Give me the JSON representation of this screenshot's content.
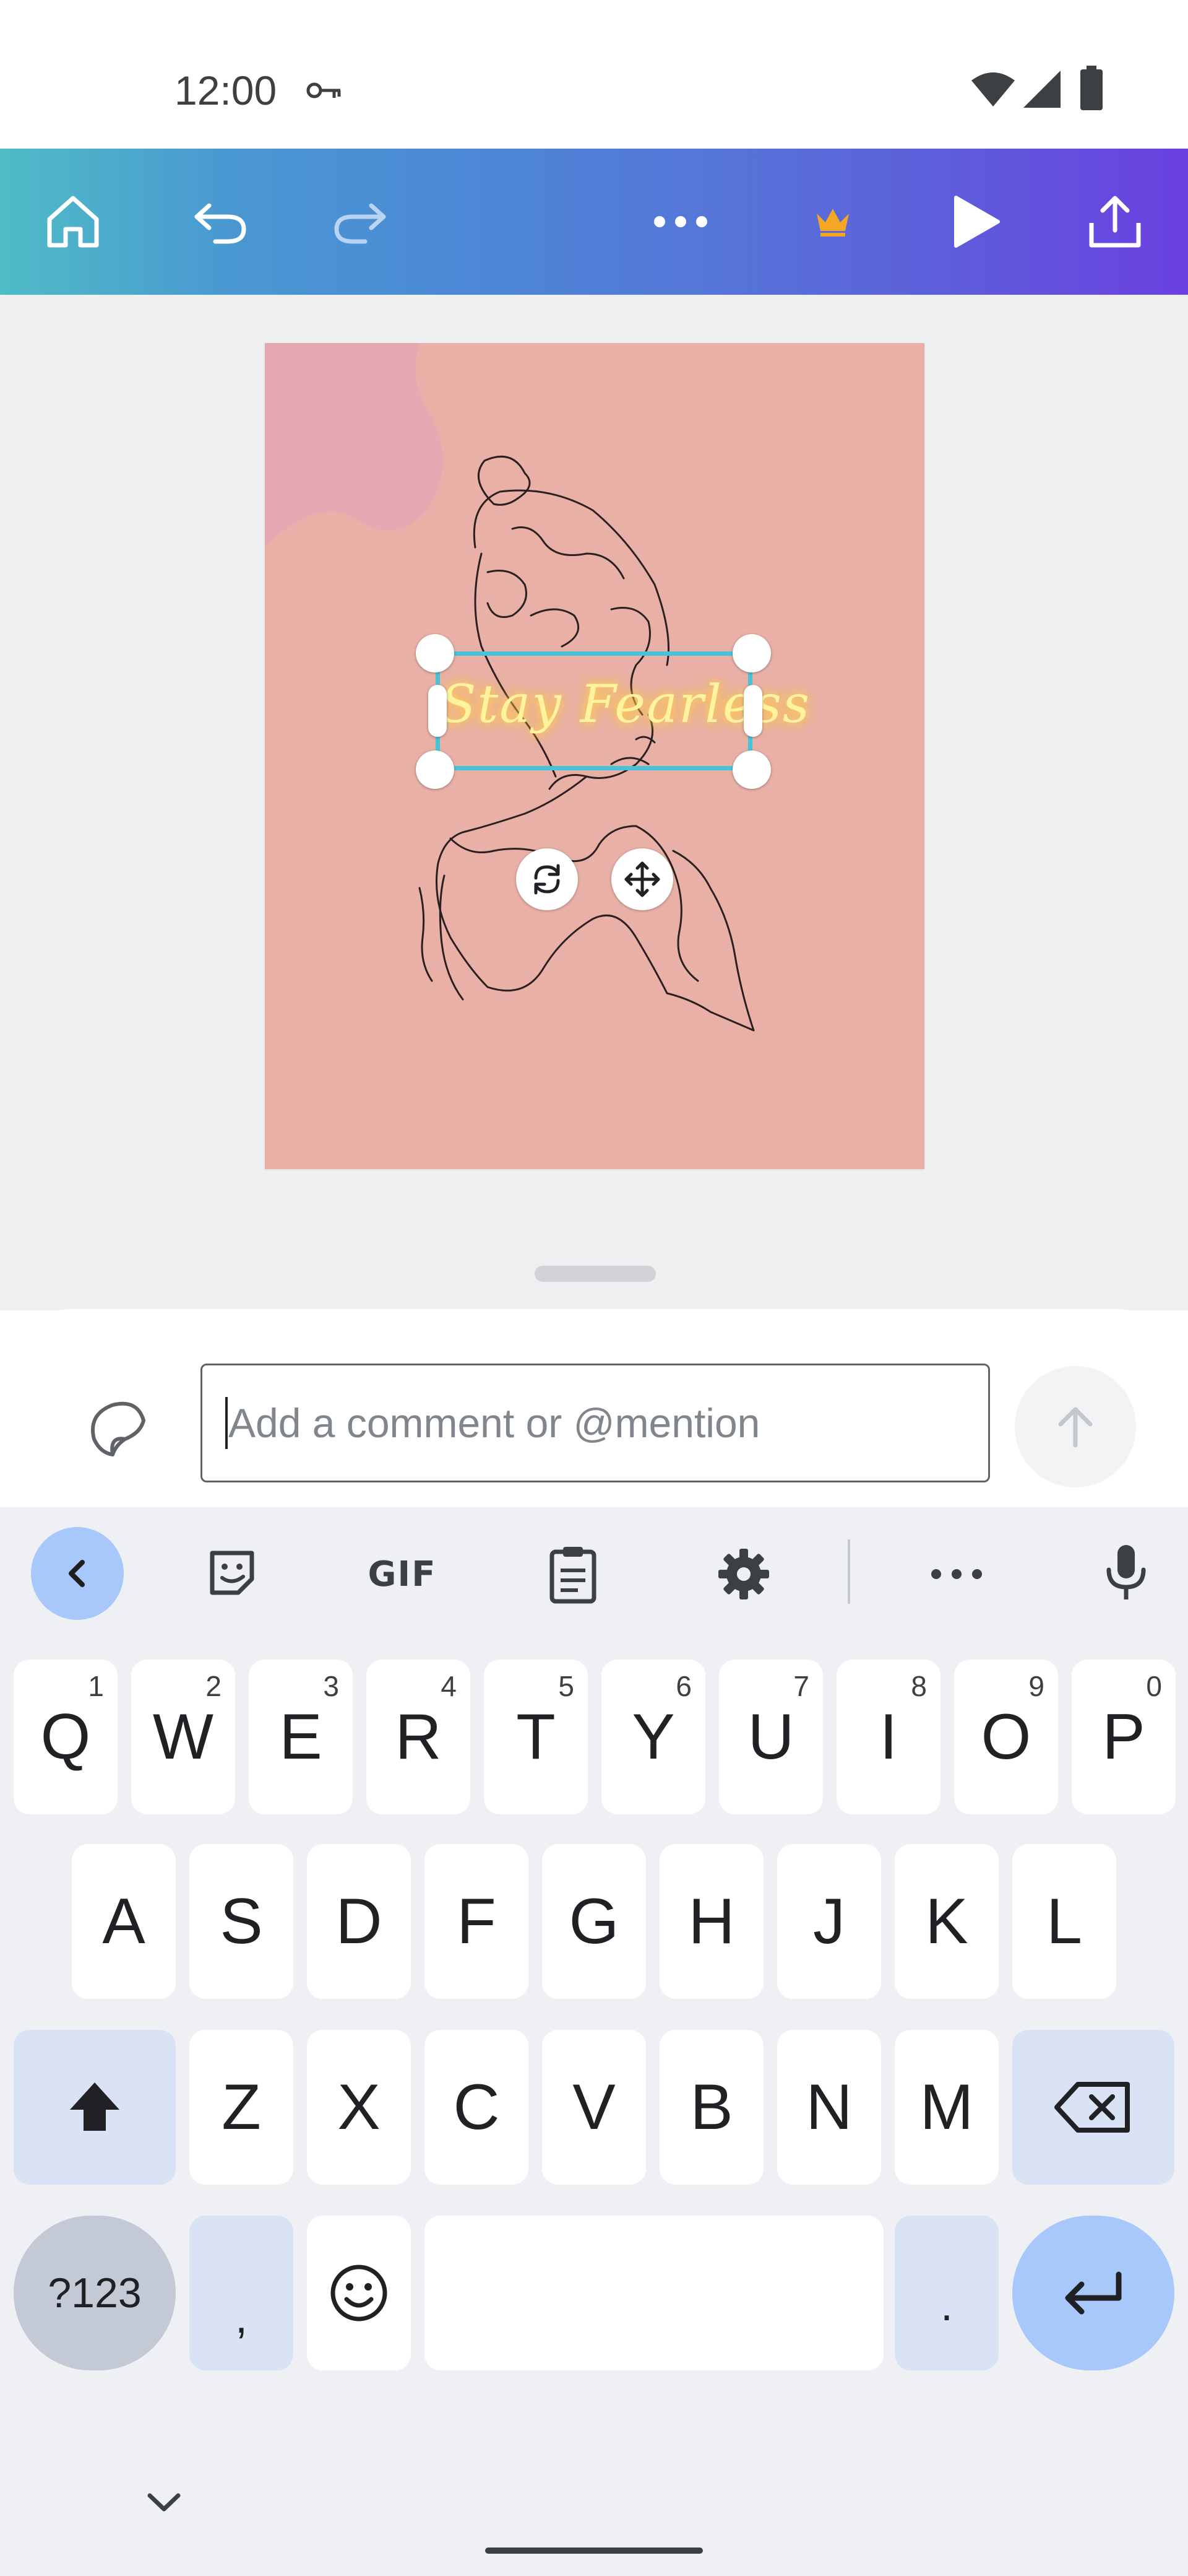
{
  "status_bar": {
    "time": "12:00",
    "icons": [
      "key-icon",
      "wifi-icon",
      "signal-icon",
      "battery-icon"
    ]
  },
  "toolbar": {
    "icons": [
      "home-icon",
      "undo-icon",
      "redo-icon",
      "more-icon",
      "crown-icon",
      "play-icon",
      "share-icon"
    ],
    "crown_color": "#f5a623"
  },
  "design": {
    "background_color": "#e8b0a7",
    "selected_text": "Stay Fearless",
    "selection_color": "#47c3d9"
  },
  "comment": {
    "placeholder": "Add a comment or @mention",
    "value": ""
  },
  "keyboard": {
    "toolbar": {
      "gif_label": "GIF",
      "icons": [
        "chevron-left-icon",
        "sticker-icon",
        "clipboard-icon",
        "settings-icon",
        "more-icon",
        "mic-icon"
      ]
    },
    "row1": [
      {
        "label": "Q",
        "hint": "1"
      },
      {
        "label": "W",
        "hint": "2"
      },
      {
        "label": "E",
        "hint": "3"
      },
      {
        "label": "R",
        "hint": "4"
      },
      {
        "label": "T",
        "hint": "5"
      },
      {
        "label": "Y",
        "hint": "6"
      },
      {
        "label": "U",
        "hint": "7"
      },
      {
        "label": "I",
        "hint": "8"
      },
      {
        "label": "O",
        "hint": "9"
      },
      {
        "label": "P",
        "hint": "0"
      }
    ],
    "row2": [
      "A",
      "S",
      "D",
      "F",
      "G",
      "H",
      "J",
      "K",
      "L"
    ],
    "row3": [
      "Z",
      "X",
      "C",
      "V",
      "B",
      "N",
      "M"
    ],
    "symbols_label": "?123",
    "comma_label": ",",
    "period_label": "."
  }
}
